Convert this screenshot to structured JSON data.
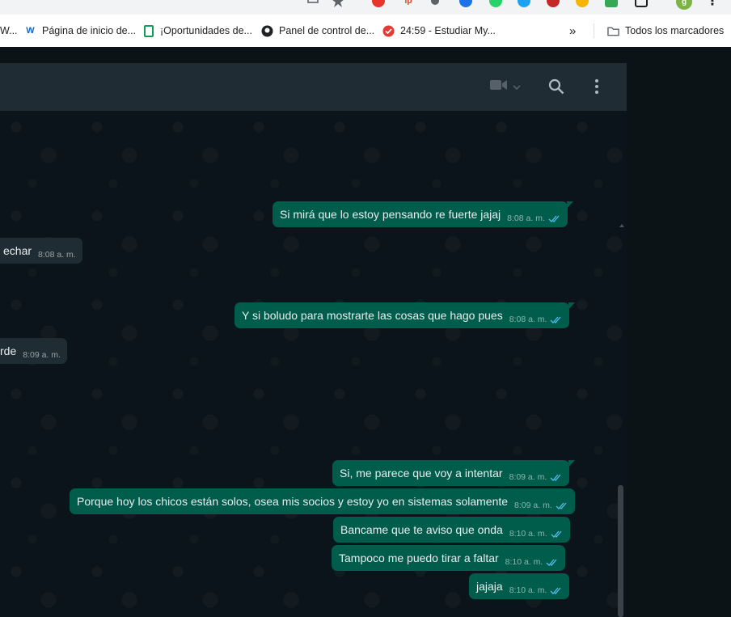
{
  "bookmarks_bar": {
    "partial_item": "W...",
    "items": [
      {
        "label": "Página de inicio de...",
        "icon": "wikipedia-w-icon"
      },
      {
        "label": "¡Oportunidades de...",
        "icon": "document-icon"
      },
      {
        "label": "Panel de control de...",
        "icon": "github-icon"
      },
      {
        "label": "24:59 - Estudiar My...",
        "icon": "check-circle-icon"
      }
    ],
    "more_label": "»",
    "all_bookmarks_label": "Todos los marcadores"
  },
  "profile": {
    "initial": "g"
  },
  "chat_header": {
    "icons": [
      "video-call-icon",
      "search-icon",
      "menu-icon"
    ]
  },
  "messages": [
    {
      "direction": "out",
      "text": "Si mirá que lo estoy pensando re fuerte jajaj",
      "time": "8:08 a. m."
    },
    {
      "direction": "in",
      "text": "echar",
      "time": "8:08 a. m."
    },
    {
      "direction": "out",
      "text": "Y si boludo para mostrarte las cosas que hago pues",
      "time": "8:08 a. m."
    },
    {
      "direction": "in",
      "text": "rde",
      "time": "8:09 a. m."
    },
    {
      "direction": "out",
      "text": "Si, me parece que voy a intentar",
      "time": "8:09 a. m."
    },
    {
      "direction": "out",
      "text": "Porque hoy los chicos están solos, osea mis socios y estoy yo en sistemas solamente",
      "time": "8:09 a. m."
    },
    {
      "direction": "out",
      "text": "Bancame que te aviso que onda",
      "time": "8:10 a. m."
    },
    {
      "direction": "out",
      "text": "Tampoco me puedo tirar a faltar",
      "time": "8:10 a. m."
    },
    {
      "direction": "out",
      "text": "jajaja",
      "time": "8:10 a. m."
    }
  ],
  "colors": {
    "outgoing_bubble": "#005c4b",
    "incoming_bubble": "#202c33",
    "header": "#202c33",
    "read_ticks": "#53bdeb"
  }
}
